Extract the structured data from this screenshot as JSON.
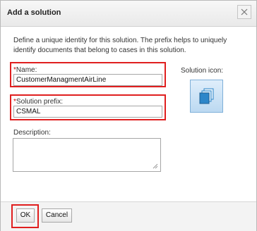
{
  "dialog": {
    "title": "Add a solution",
    "description": "Define a unique identity for this solution. The prefix helps to uniquely identify documents that belong to cases in this solution.",
    "close_icon": "close-icon"
  },
  "form": {
    "name_required_marker": "*",
    "name_label": "Name:",
    "name_value": "CustomerManagmentAirLine",
    "prefix_required_marker": "*",
    "prefix_label": "Solution prefix:",
    "prefix_value": "CSMAL",
    "description_label": "Description:",
    "description_value": "",
    "solution_icon_label": "Solution icon:",
    "solution_icon": "stacked-documents-icon"
  },
  "footer": {
    "ok_label": "OK",
    "cancel_label": "Cancel"
  },
  "colors": {
    "highlight": "#e01f1f",
    "icon_accent": "#2d86c9"
  }
}
